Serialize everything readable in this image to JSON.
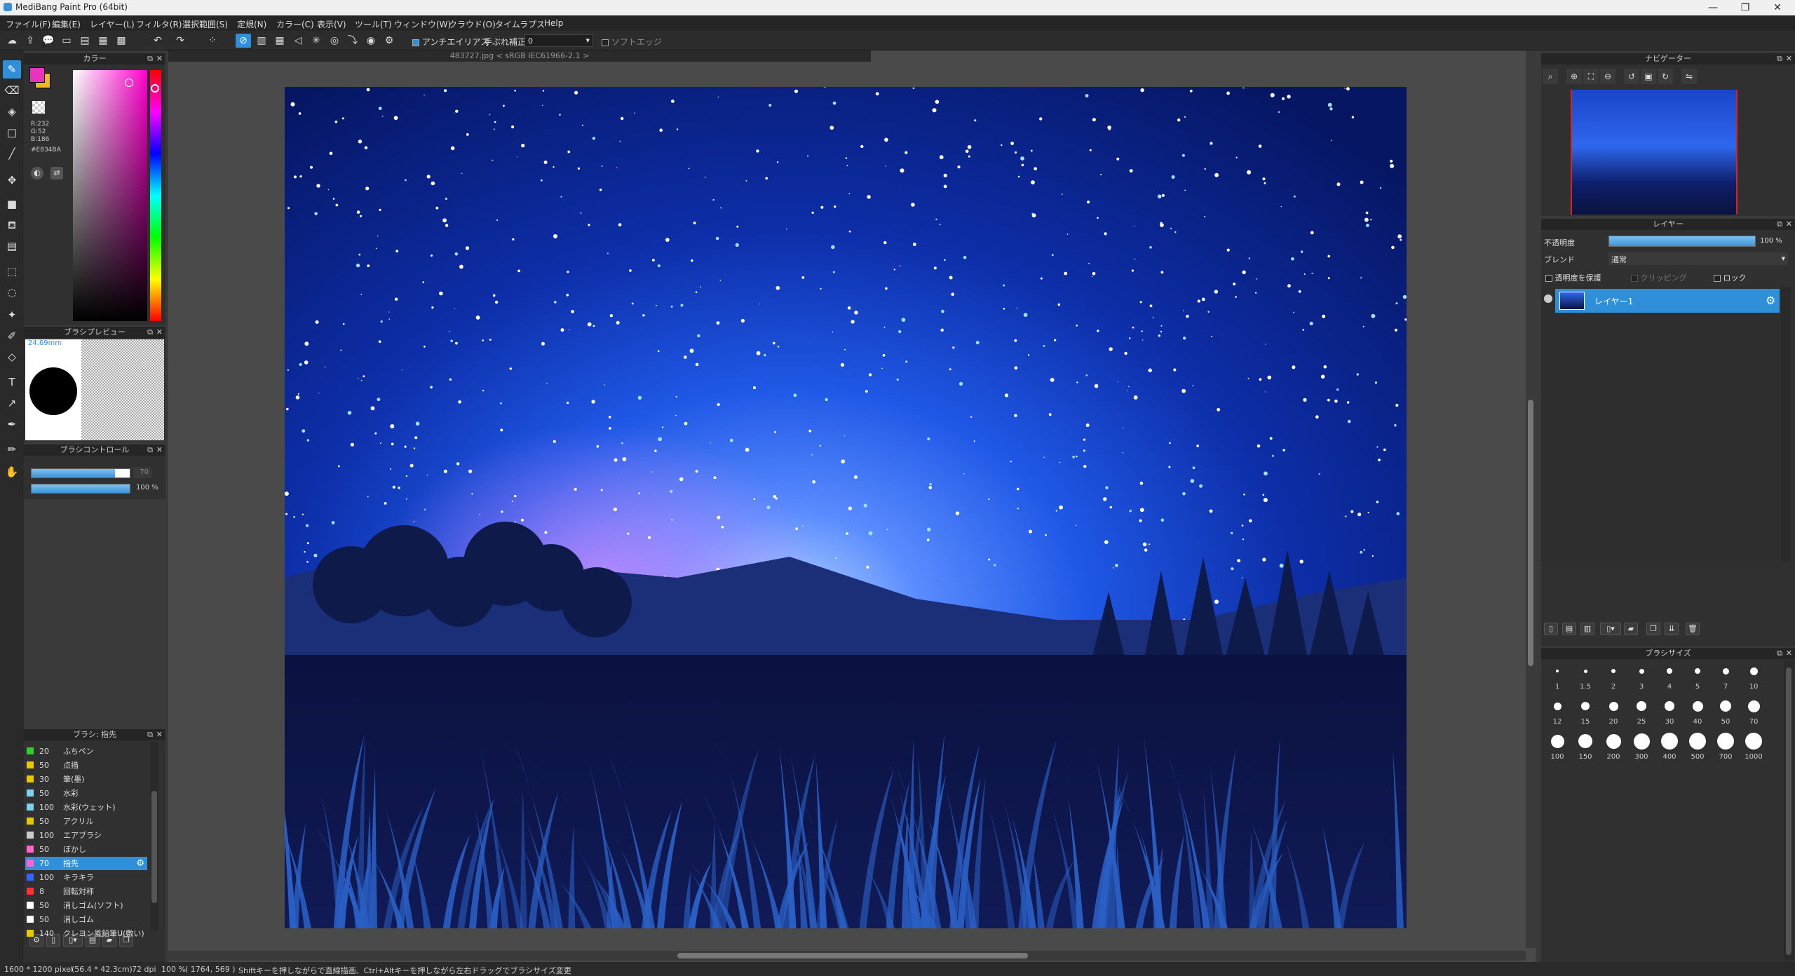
{
  "window": {
    "title": "MediBang Paint Pro (64bit)",
    "minimize_glyph": "—",
    "maximize_glyph": "❐",
    "close_glyph": "✕"
  },
  "menu": [
    "ファイル(F)",
    "編集(E)",
    "レイヤー(L)",
    "フィルタ(R)",
    "選択範囲(S)",
    "定規(N)",
    "カラー(C)",
    "表示(V)",
    "ツール(T)",
    "ウィンドウ(W)",
    "クラウド(O)",
    "タイムラプス",
    "Help"
  ],
  "toolbar": {
    "antialias_label": "アンチエイリアス",
    "stabilizer_label": "手ぶれ補正",
    "stabilizer_value": "0",
    "soft_edge_label": "ソフトエッジ"
  },
  "document_tab": "483727.jpg < sRGB IEC61966-2.1 >",
  "color_panel": {
    "title": "カラー",
    "r": "R:232",
    "g": "G:52",
    "b": "B:186",
    "hex": "#E834BA",
    "primary_color": "#e834ba",
    "secondary_color": "#f2b822"
  },
  "brush_preview": {
    "title": "ブラシプレビュー",
    "size_mm": "24.69mm"
  },
  "brush_control": {
    "title": "ブラシコントロール",
    "size_value": "70",
    "size_fraction": 0.85,
    "opacity_value": "100 %",
    "opacity_fraction": 1.0
  },
  "brush_list": {
    "title": "ブラシ: 指先",
    "items": [
      {
        "size": "20",
        "name": "ふちペン",
        "color": "#33cc33"
      },
      {
        "size": "50",
        "name": "点描",
        "color": "#e8c800"
      },
      {
        "size": "30",
        "name": "筆(墨)",
        "color": "#e8c800"
      },
      {
        "size": "50",
        "name": "水彩",
        "color": "#7fd0f0"
      },
      {
        "size": "100",
        "name": "水彩(ウェット)",
        "color": "#7fd0f0"
      },
      {
        "size": "50",
        "name": "アクリル",
        "color": "#e8c800"
      },
      {
        "size": "100",
        "name": "エアブラシ",
        "color": "#cccccc"
      },
      {
        "size": "50",
        "name": "ぼかし",
        "color": "#ff66cc"
      },
      {
        "size": "70",
        "name": "指先",
        "color": "#ff66cc",
        "selected": true
      },
      {
        "size": "100",
        "name": "キラキラ",
        "color": "#3366ff"
      },
      {
        "size": "8",
        "name": "回転対称",
        "color": "#ff3333"
      },
      {
        "size": "50",
        "name": "消しゴム(ソフト)",
        "color": "#ffffff"
      },
      {
        "size": "50",
        "name": "消しゴム",
        "color": "#ffffff"
      },
      {
        "size": "140",
        "name": "クレヨン風鉛筆U(敷い)",
        "color": "#e8c800"
      }
    ]
  },
  "navigator": {
    "title": "ナビゲーター"
  },
  "layer_panel": {
    "title": "レイヤー",
    "opacity_label": "不透明度",
    "opacity_value": "100 %",
    "opacity_fraction": 1.0,
    "blend_label": "ブレンド",
    "blend_value": "通常",
    "protect_alpha_label": "透明度を保護",
    "clipping_label": "クリッピング",
    "lock_label": "ロック",
    "layers": [
      {
        "name": "レイヤー1"
      }
    ]
  },
  "brush_size_panel": {
    "title": "ブラシサイズ",
    "sizes": [
      "1",
      "1.5",
      "2",
      "3",
      "4",
      "5",
      "7",
      "10",
      "12",
      "15",
      "20",
      "25",
      "30",
      "40",
      "50",
      "70",
      "100",
      "150",
      "200",
      "300",
      "400",
      "500",
      "700",
      "1000"
    ]
  },
  "status": {
    "image_size": "1600 * 1200 pixel",
    "physical_size": "(56.4 * 42.3cm)",
    "dpi": "72 dpi",
    "zoom": "100 %",
    "cursor": "( 1764, 569 )",
    "hint": "Shiftキーを押しながらで直線描画、Ctrl+Altキーを押しながら左右ドラッグでブラシサイズ変更"
  }
}
